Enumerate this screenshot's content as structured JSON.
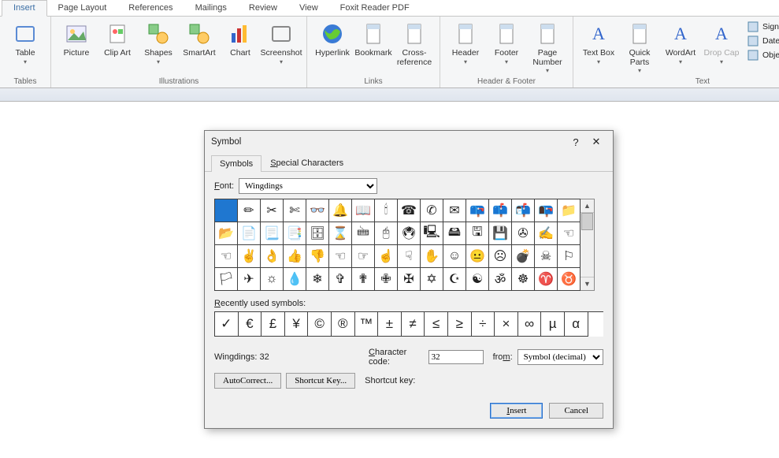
{
  "tabs": [
    "Insert",
    "Page Layout",
    "References",
    "Mailings",
    "Review",
    "View",
    "Foxit Reader PDF"
  ],
  "active_tab": 0,
  "ribbon": {
    "groups": [
      {
        "label": "Tables",
        "items": [
          {
            "label": "Table",
            "drop": true
          }
        ]
      },
      {
        "label": "Illustrations",
        "items": [
          {
            "label": "Picture"
          },
          {
            "label": "Clip Art"
          },
          {
            "label": "Shapes",
            "drop": true
          },
          {
            "label": "SmartArt"
          },
          {
            "label": "Chart"
          },
          {
            "label": "Screenshot",
            "drop": true
          }
        ]
      },
      {
        "label": "Links",
        "items": [
          {
            "label": "Hyperlink"
          },
          {
            "label": "Bookmark"
          },
          {
            "label": "Cross-reference"
          }
        ]
      },
      {
        "label": "Header & Footer",
        "items": [
          {
            "label": "Header",
            "drop": true
          },
          {
            "label": "Footer",
            "drop": true
          },
          {
            "label": "Page Number",
            "drop": true
          }
        ]
      },
      {
        "label": "Text",
        "items": [
          {
            "label": "Text Box",
            "drop": true
          },
          {
            "label": "Quick Parts",
            "drop": true
          },
          {
            "label": "WordArt",
            "drop": true
          },
          {
            "label": "Drop Cap",
            "drop": true,
            "disabled": true
          }
        ],
        "side": [
          {
            "label": "Signature Line",
            "drop": true
          },
          {
            "label": "Date & Time"
          },
          {
            "label": "Object",
            "drop": true
          }
        ]
      }
    ]
  },
  "dialog": {
    "title": "Symbol",
    "tabs": [
      "Symbols",
      "Special Characters"
    ],
    "active_tab": 0,
    "font_label": "Font:",
    "font_value": "Wingdings",
    "grid": [
      [
        " ",
        "✏",
        "✂",
        "✄",
        "👓",
        "🔔",
        "📖",
        "🕯",
        "☎",
        "✆",
        "✉",
        "📪",
        "📫",
        "📬",
        "📭",
        "📁"
      ],
      [
        "📂",
        "📄",
        "📃",
        "📑",
        "🗄",
        "⌛",
        "🖮",
        "🖰",
        "🖲",
        "🖳",
        "🖴",
        "🖫",
        "💾",
        "✇",
        "✍",
        "☜"
      ],
      [
        "☜",
        "✌",
        "👌",
        "👍",
        "👎",
        "☜",
        "☞",
        "☝",
        "☟",
        "✋",
        "☺",
        "😐",
        "☹",
        "💣",
        "☠",
        "⚐"
      ],
      [
        "🏳",
        "✈",
        "☼",
        "💧",
        "❄",
        "✞",
        "✟",
        "✙",
        "✠",
        "✡",
        "☪",
        "☯",
        "ॐ",
        "☸",
        "♈",
        "♉"
      ]
    ],
    "selected_index": 0,
    "recent_label": "Recently used symbols:",
    "recent": [
      "✓",
      "€",
      "£",
      "¥",
      "©",
      "®",
      "™",
      "±",
      "≠",
      "≤",
      "≥",
      "÷",
      "×",
      "∞",
      "µ",
      "α"
    ],
    "code_name": "Wingdings: 32",
    "code_label": "Character code:",
    "code_value": "32",
    "from_label": "from:",
    "from_value": "Symbol (decimal)",
    "autocorrect": "AutoCorrect...",
    "shortcut_btn": "Shortcut Key...",
    "shortcut_label": "Shortcut key:",
    "insert": "Insert",
    "cancel": "Cancel"
  }
}
